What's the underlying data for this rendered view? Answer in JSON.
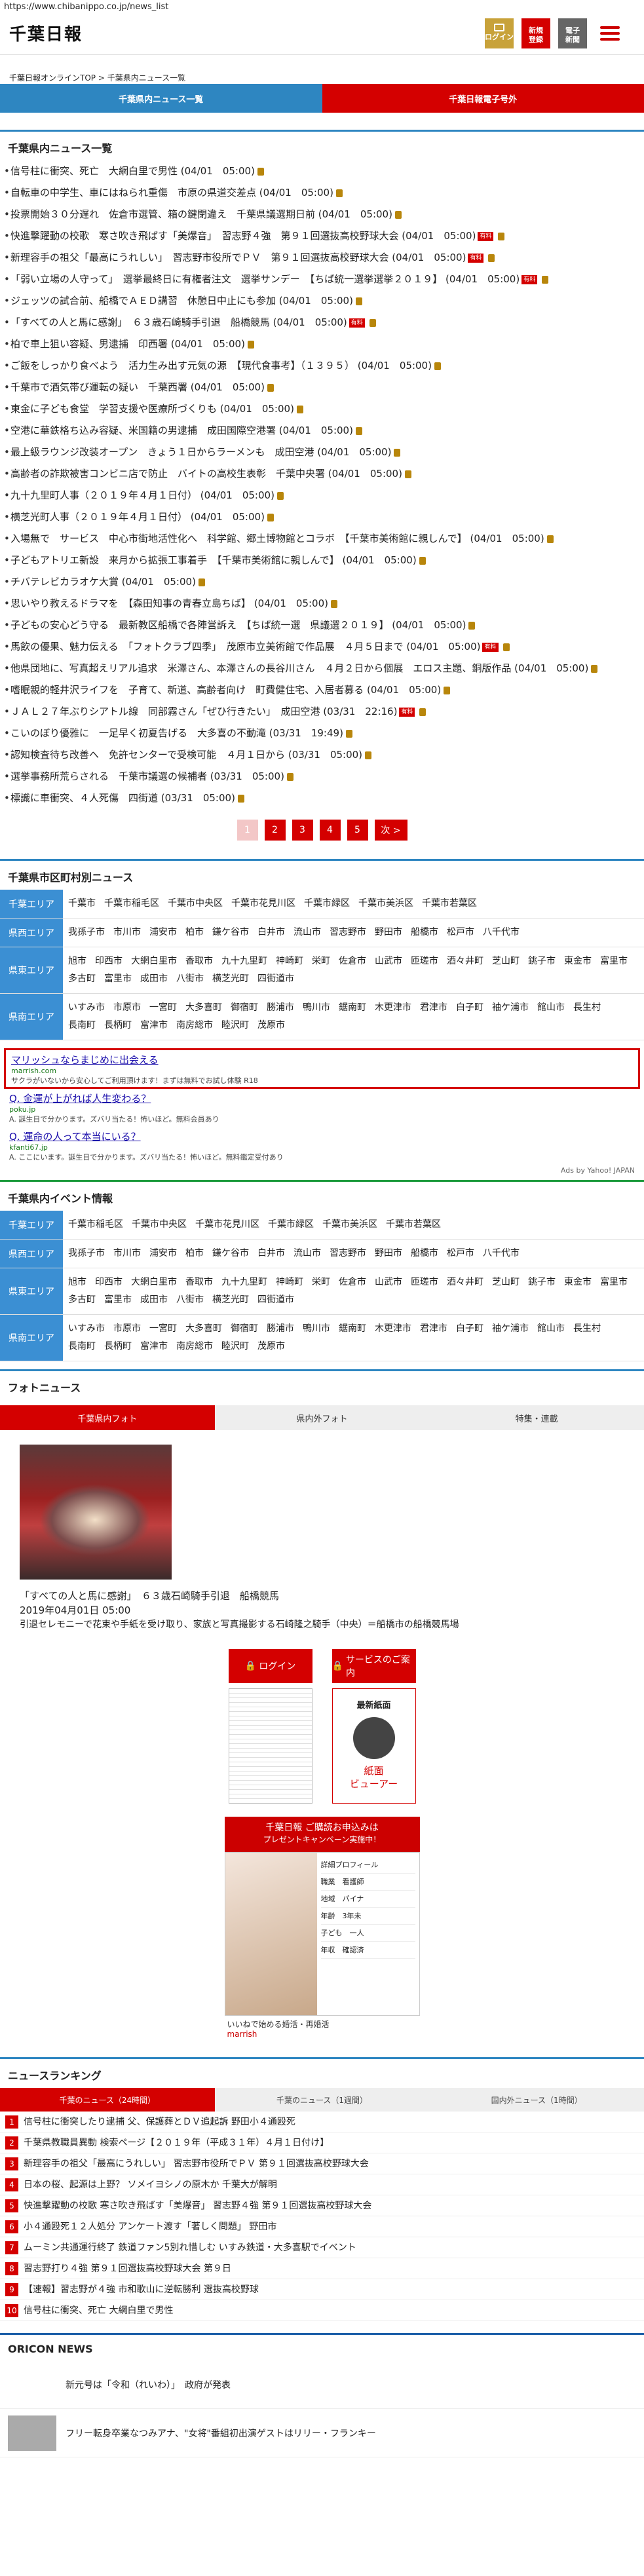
{
  "browser": {
    "url": "https://www.chibanippo.co.jp/news_list"
  },
  "header": {
    "logo": "千葉日報",
    "login": "ログイン",
    "register": "新規\n登録",
    "paper": "電子\n新聞"
  },
  "breadcrumb": {
    "home": "千葉日報オンラインTOP",
    "sep": " > ",
    "current": "千葉県内ニュース一覧"
  },
  "top_tabs": [
    "千葉県内ニュース一覧",
    "千葉日報電子号外"
  ],
  "news": {
    "title": "千葉県内ニュース一覧",
    "items": [
      "信号柱に衝突、死亡　大網白里で男性 (04/01　05:00)",
      "自転車の中学生、車にはねられ重傷　市原の県道交差点 (04/01　05:00)",
      "投票開始３０分遅れ　佐倉市選管、箱の鍵閉違え　千葉県議選期日前 (04/01　05:00)",
      "快進撃躍動の校歌　寒さ吹き飛ばす「美爆音」　習志野４強　第９１回選抜高校野球大会 (04/01　05:00)",
      "新理容手の祖父「最高にうれしい」　習志野市役所でＰＶ　第９１回選抜高校野球大会 (04/01　05:00)",
      "「弱い立場の人守って」　選挙最終日に有権者注文　選挙サンデー　【ちば統一選挙選挙２０１９】 (04/01　05:00)",
      "ジェッツの試合前、船橋でＡＥＤ講習　休憩日中止にも参加 (04/01　05:00)",
      "「すべての人と馬に感謝」　６３歳石崎騎手引退　船橋競馬 (04/01　05:00)",
      "柏で車上狙い容疑、男逮捕　印西署 (04/01　05:00)",
      "ご飯をしっかり食べよう　活力生み出す元気の源　【現代食事考】（１３９５） (04/01　05:00)",
      "千葉市で酒気帯び運転の疑い　千葉西署 (04/01　05:00)",
      "東金に子ども食堂　学習支援や医療所づくりも (04/01　05:00)",
      "空港に華鉄格ち込み容疑、米国籍の男逮捕　成田国際空港署 (04/01　05:00)",
      "最上級ラウンジ改装オープン　きょう１日からラーメンも　成田空港 (04/01　05:00)",
      "高齢者の詐欺被害コンビニ店で防止　バイトの高校生表彰　千葉中央署 (04/01　05:00)",
      "九十九里町人事（２０１９年４月１日付） (04/01　05:00)",
      "横芝光町人事（２０１９年４月１日付） (04/01　05:00)",
      "入場無で　サービス　中心市街地活性化へ　科学館、郷土博物館とコラボ　【千葉市美術館に親しんで】 (04/01　05:00)",
      "子どもアトリエ新設　来月から拡張工事着手　【千葉市美術館に親しんで】 (04/01　05:00)",
      "チバテレビカラオケ大賞 (04/01　05:00)",
      "思いやり教えるドラマを　【森田知事の青春立島ちば】 (04/01　05:00)",
      "子どもの安心どう守る　最新教区船橋で各陣営訴え　【ちば統一選　県議選２０１９】 (04/01　05:00)",
      "馬飲の優果、魅力伝える　「フォトクラブ四季」　茂原市立美術館で作品展　４月５日まで (04/01　05:00)",
      "他県団地に、写真超えリアル追求　米澤さん、本澤さんの長谷川さん　４月２日から個展　エロス主題、銅版作品 (04/01　05:00)",
      "嗜眠親的軽井沢ライフを　子育て、新道、高齢者向け　町費健住宅、入居者募る (04/01　05:00)",
      "ＪＡＬ２７年ぶりシアトル線　同部霧さん「ぜひ行きたい」　成田空港 (03/31　22:16)",
      "こいのぼり優雅に　一足早く初夏告げる　大多喜の不動滝 (03/31　19:49)",
      "認知検査待ち改善へ　免許センターで受検可能　４月１日から (03/31　05:00)",
      "選挙事務所荒らされる　千葉市議選の候補者 (03/31　05:00)",
      "標識に車衝突、４人死傷　四街道 (03/31　05:00)"
    ]
  },
  "pager": [
    "1",
    "2",
    "3",
    "4",
    "5",
    "次 >"
  ],
  "areas": {
    "title": "千葉県市区町村別ニュース",
    "rows": [
      {
        "label": "千葉エリア",
        "cities": [
          "千葉市",
          "千葉市稲毛区",
          "千葉市中央区",
          "千葉市花見川区",
          "千葉市緑区",
          "千葉市美浜区",
          "千葉市若葉区"
        ]
      },
      {
        "label": "県西エリア",
        "cities": [
          "我孫子市",
          "市川市",
          "浦安市",
          "柏市",
          "鎌ケ谷市",
          "白井市",
          "流山市",
          "習志野市",
          "野田市",
          "船橋市",
          "松戸市",
          "八千代市"
        ]
      },
      {
        "label": "県東エリア",
        "cities": [
          "旭市",
          "印西市",
          "大網白里市",
          "香取市",
          "九十九里町",
          "神崎町",
          "栄町",
          "佐倉市",
          "山武市",
          "匝瑳市",
          "酒々井町",
          "芝山町",
          "銚子市",
          "東金市",
          "富里市",
          "多古町",
          "富里市",
          "成田市",
          "八街市",
          "横芝光町",
          "四街道市"
        ]
      },
      {
        "label": "県南エリア",
        "cities": [
          "いすみ市",
          "市原市",
          "一宮町",
          "大多喜町",
          "御宿町",
          "勝浦市",
          "鴨川市",
          "鋸南町",
          "木更津市",
          "君津市",
          "白子町",
          "袖ケ浦市",
          "館山市",
          "長生村",
          "長南町",
          "長柄町",
          "富津市",
          "南房総市",
          "睦沢町",
          "茂原市"
        ]
      }
    ]
  },
  "ads": [
    {
      "title": "マリッシュならまじめに出会える",
      "url": "marrish.com",
      "desc": "サクラがいないから安心してご利用頂けます！まずは無料でお試し体験 R18"
    },
    {
      "title": "Q. 金運が上がれば人生変わる？",
      "url": "poku.jp",
      "desc": "A. 誕生日で分かります。ズバリ当たる！怖いほど。無料会員あり"
    },
    {
      "title": "Q. 運命の人って本当にいる？",
      "url": "kfanti67.jp",
      "desc": "A. ここにいます。誕生日で分かります。ズバリ当たる！怖いほど。無料鑑定受付あり"
    }
  ],
  "adsby": "Ads by Yahoo! JAPAN",
  "events": {
    "title": "千葉県内イベント情報",
    "rows": [
      {
        "label": "千葉エリア",
        "cities": [
          "千葉市稲毛区",
          "千葉市中央区",
          "千葉市花見川区",
          "千葉市緑区",
          "千葉市美浜区",
          "千葉市若葉区"
        ]
      },
      {
        "label": "県西エリア",
        "cities": [
          "我孫子市",
          "市川市",
          "浦安市",
          "柏市",
          "鎌ケ谷市",
          "白井市",
          "流山市",
          "習志野市",
          "野田市",
          "船橋市",
          "松戸市",
          "八千代市"
        ]
      },
      {
        "label": "県東エリア",
        "cities": [
          "旭市",
          "印西市",
          "大網白里市",
          "香取市",
          "九十九里町",
          "神崎町",
          "栄町",
          "佐倉市",
          "山武市",
          "匝瑳市",
          "酒々井町",
          "芝山町",
          "銚子市",
          "東金市",
          "富里市",
          "多古町",
          "富里市",
          "成田市",
          "八街市",
          "横芝光町",
          "四街道市"
        ]
      },
      {
        "label": "県南エリア",
        "cities": [
          "いすみ市",
          "市原市",
          "一宮町",
          "大多喜町",
          "御宿町",
          "勝浦市",
          "鴨川市",
          "鋸南町",
          "木更津市",
          "君津市",
          "白子町",
          "袖ケ浦市",
          "館山市",
          "長生村",
          "長南町",
          "長柄町",
          "富津市",
          "南房総市",
          "睦沢町",
          "茂原市"
        ]
      }
    ]
  },
  "photo": {
    "title": "フォトニュース",
    "tabs": [
      "千葉県内フォト",
      "県内外フォト",
      "特集・連載"
    ],
    "caption": "「すべての人と馬に感謝」　６３歳石崎騎手引退　船橋競馬",
    "date": "2019年04月01日 05:00",
    "sub": "引退セレモニーで花束や手紙を受け取り、家族と写真撮影する石崎隆之騎手（中央）＝船橋市の船橋競馬場"
  },
  "side": {
    "login": "ログイン",
    "service": "サービスのご案内",
    "paper_label": "最新紙面",
    "viewer": "紙面\nビューアー",
    "banner_top": "千葉日報 ご購読お申込みは",
    "banner_sub": "プレゼントキャンペーン実施中！",
    "profile": [
      "詳細プロフィール",
      "職業　看護師",
      "地域　パイナ",
      "年齢　3年未",
      "子ども　一人",
      "年収　確認済"
    ],
    "banner_foot": "いいねで始める婚活・再婚活",
    "banner_brand": "marrish"
  },
  "ranking": {
    "title": "ニュースランキング",
    "tabs": [
      "千葉のニュース（24時間）",
      "千葉のニュース（1週間）",
      "国内外ニュース（1時間）"
    ],
    "items": [
      "信号柱に衝突したり逮捕 父、保護葬とＤＶ追起訴 野田小４通殴死",
      "千葉県教職員異動 検索ページ【２０１９年（平成３１年）４月１日付け】",
      "新理容手の祖父「最高にうれしい」 習志野市役所でＰＶ 第９１回選抜高校野球大会",
      "日本の桜、起源は上野？ ソメイヨシノの原木か 千葉大が解明",
      "快進撃躍動の校歌 寒さ吹き飛ばす「美爆音」 習志野４強 第９１回選抜高校野球大会",
      "小４通殴死１２人処分 アンケート渡す「著しく問題」 野田市",
      "ムーミン共通運行終了 鉄道ファン5別れ惜しむ いすみ鉄道・大多喜駅でイベント",
      "習志野打り４強 第９１回選抜高校野球大会 第９日",
      "【速報】習志野が４強 市和歌山に逆転勝利 選抜高校野球",
      "信号柱に衝突、死亡 大網白里で男性"
    ]
  },
  "oricon": {
    "title": "ORICON NEWS",
    "items": [
      "新元号は「令和（れいわ）」　政府が発表",
      "フリー転身卒業なつみアナ、\"女将\"番組初出演ゲストはリリー・フランキー"
    ]
  }
}
